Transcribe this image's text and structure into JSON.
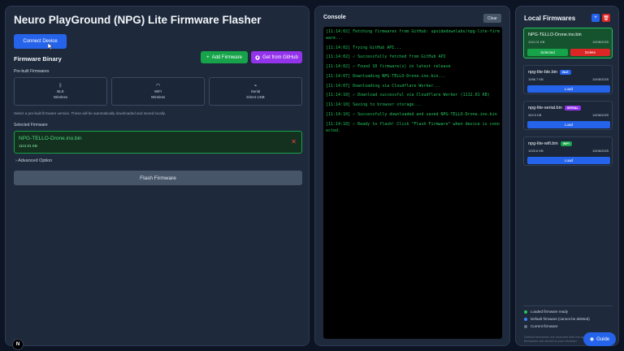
{
  "app": {
    "title": "Neuro PlayGround (NPG) Lite Firmware Flasher",
    "connect_label": "Connect Device"
  },
  "firmware_binary": {
    "title": "Firmware Binary",
    "add_label": "Add Firmware",
    "github_label": "Get from GitHub",
    "prebuilt_label": "Pre-built Firmwares",
    "options": [
      {
        "name": "BLE",
        "sub": "Wireless",
        "icon": "bluetooth-icon"
      },
      {
        "name": "WiFi",
        "sub": "Wireless",
        "icon": "wifi-icon"
      },
      {
        "name": "Serial",
        "sub": "Direct USB",
        "icon": "usb-icon"
      }
    ],
    "hint": "Select a pre-built firmware version. These will be automatically downloaded and stored locally.",
    "selected_label": "Selected Firmware",
    "selected_name": "NPG-TELLO-Drone.ino.bin",
    "selected_size": "1112.01 KB",
    "advanced_label": "Advanced Option",
    "flash_label": "Flash Firmware"
  },
  "console": {
    "title": "Console",
    "clear_label": "Clear",
    "lines": [
      "[11:14:02] Fetching firmwares from GitHub: upsidedownlabs/npg-lite-firmware...",
      "[11:14:02] Trying GitHub API...",
      "[11:14:02] ✓ Successfully fetched from GitHub API",
      "[11:14:02] ✓ Found 10 firmware(s) in latest release",
      "[11:14:07] Downloading NPG-TELLO-Drone.ino.bin...",
      "[11:14:07] Downloading via Cloudflare Worker...",
      "[11:14:10] ✓ Download successful via Cloudflare Worker (1112.01 KB)",
      "[11:14:10] Saving to browser storage...",
      "[11:14:10] ✓ Successfully downloaded and saved NPG-TELLO-Drone.ino.bin",
      "[11:14:10] ✓ Ready to flash! Click \"Flash Firmware\" when device is connected."
    ]
  },
  "local_firmwares": {
    "title": "Local Firmwares",
    "items": [
      {
        "name": "NPG-TELLO-Drone.ino.bin",
        "size": "1112.01 KB",
        "date": "10/08/2025",
        "tag": "",
        "tag_color": "",
        "active": true,
        "select_label": "Selected",
        "delete_label": "Delete"
      },
      {
        "name": "npg-lite-ble.bin",
        "size": "1096.7 KB",
        "date": "10/08/2025",
        "tag": "BLE",
        "tag_color": "#2563eb",
        "active": false,
        "load_label": "Load"
      },
      {
        "name": "npg-lite-serial.bin",
        "size": "349.9 KB",
        "date": "10/08/2025",
        "tag": "SERIAL",
        "tag_color": "#9333ea",
        "active": false,
        "load_label": "Load"
      },
      {
        "name": "npg-lite-wifi.bin",
        "size": "1025.6 KB",
        "date": "10/08/2025",
        "tag": "WIFI",
        "tag_color": "#16a34a",
        "active": false,
        "load_label": "Load"
      }
    ],
    "legend": [
      {
        "label": "Loaded firmware ready",
        "color": "#22c55e"
      },
      {
        "label": "Default firmware (cannot be deleted)",
        "color": "#3b82f6"
      },
      {
        "label": "Current firmware",
        "color": "#64748b"
      }
    ],
    "default_note": "Default firmwares are included with the app. All firmwares are stored in your browser."
  },
  "guide_label": "Guide",
  "logo_text": "N",
  "colors": {
    "accent_blue": "#2563eb",
    "success_green": "#16a34a",
    "danger_red": "#dc2626",
    "purple": "#9333ea",
    "console_text": "#22c55e"
  }
}
